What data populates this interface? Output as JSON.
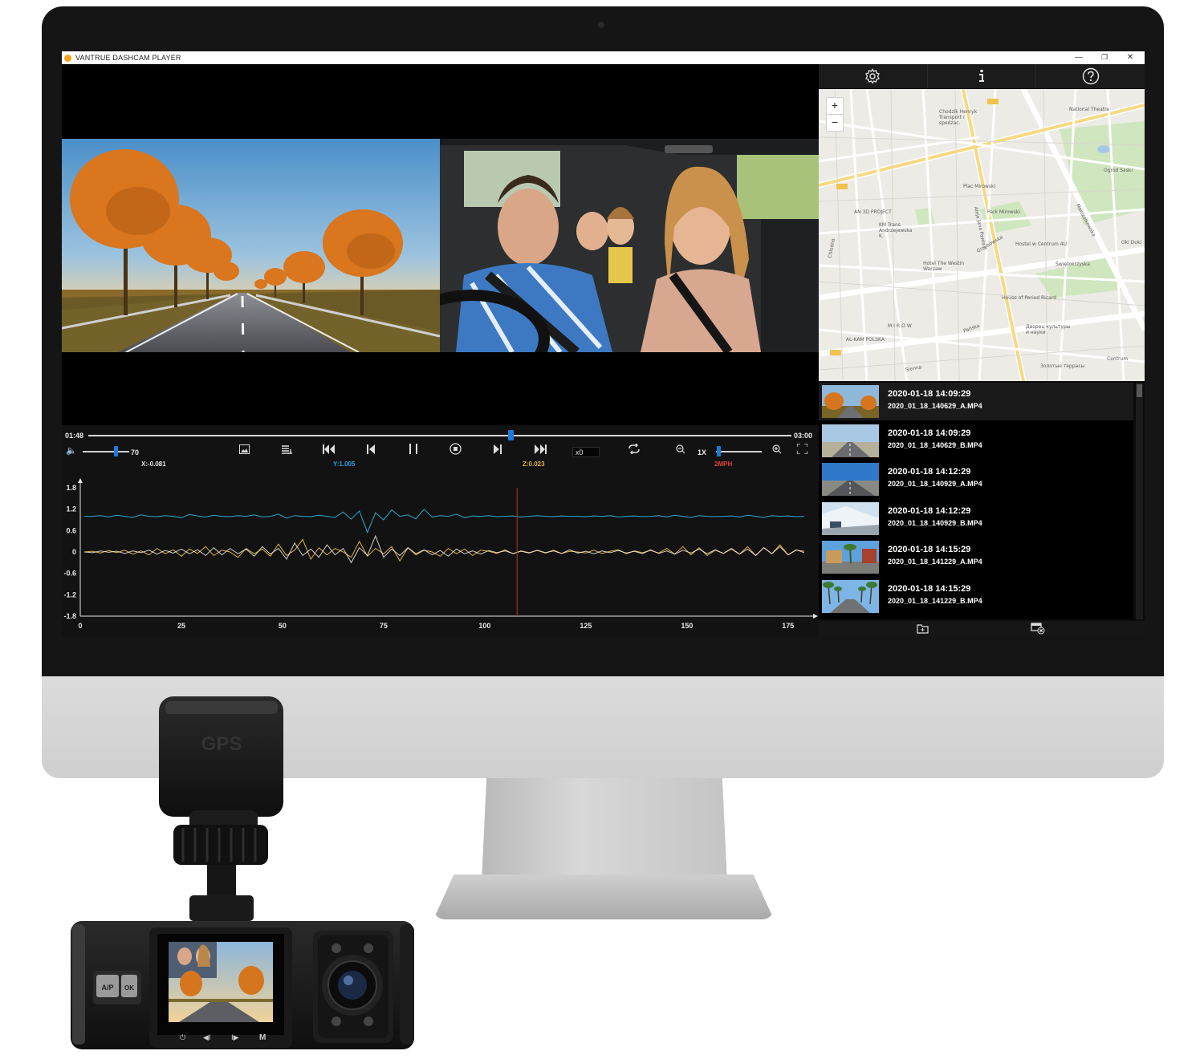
{
  "window": {
    "title": "VANTRUE DASHCAM PLAYER",
    "minimize_glyph": "—",
    "restore_glyph": "❐",
    "close_glyph": "✕"
  },
  "playback": {
    "current_time": "01:48",
    "total_time": "03:00",
    "progress_fraction": 0.6,
    "volume_value": "70",
    "volume_fraction": 0.7,
    "speed_label": "x0",
    "rate_label": "1X",
    "zoom_fraction": 0.05
  },
  "controls": {
    "volume_icon": "speaker-icon",
    "snapshot_icon": "image-icon",
    "playlist_icon": "list-icon",
    "skip_back_icon": "skip-to-start-icon",
    "prev_frame_icon": "previous-icon",
    "pause_icon": "pause-icon",
    "stop_icon": "stop-icon",
    "next_frame_icon": "next-icon",
    "skip_forward_icon": "skip-to-end-icon",
    "loop_icon": "repeat-icon",
    "zoom_out_icon": "zoom-out-icon",
    "zoom_in_icon": "zoom-in-icon",
    "fullscreen_icon": "fullscreen-icon"
  },
  "readouts": {
    "x": {
      "text": "X:-0.081",
      "color": "#e6e6e6"
    },
    "y": {
      "text": "Y:1.005",
      "color": "#2a9fd6"
    },
    "z": {
      "text": "Z:0.023",
      "color": "#e2b13c"
    },
    "speed": {
      "text": "2MPH",
      "color": "#e2403a"
    }
  },
  "chart_data": {
    "type": "line",
    "x_range": [
      0,
      180
    ],
    "ylim": [
      -1.8,
      1.8
    ],
    "yticks": [
      "1.8",
      "1.2",
      "0.6",
      "0",
      "-0.6",
      "-1.2",
      "-1.8"
    ],
    "xticks": [
      "0",
      "25",
      "50",
      "75",
      "100",
      "125",
      "150",
      "175"
    ],
    "cursor_x": 108,
    "series": [
      {
        "color": "#2aa9c9",
        "baseline": 1.0,
        "spike_x": 61,
        "spike_y": 0.5,
        "values": [
          1.0,
          1.0,
          1.02,
          0.98,
          1.03,
          1.0,
          0.97,
          1.04,
          1.0,
          0.99,
          1.02,
          1.0,
          0.96,
          1.05,
          1.01,
          0.98,
          1.03,
          1.0,
          0.99,
          1.02,
          1.0,
          1.04,
          0.98,
          1.0,
          1.06,
          0.95,
          1.02,
          1.0,
          0.99,
          1.03,
          1.0,
          0.97,
          1.12,
          0.92,
          1.15,
          0.55,
          1.1,
          0.9,
          1.18,
          1.0,
          1.04,
          0.93,
          1.2,
          0.98,
          1.02,
          1.0,
          1.06,
          0.96,
          1.01,
          1.0,
          1.02,
          0.99,
          1.0,
          1.01,
          0.98,
          1.0,
          1.02,
          1.0,
          0.99,
          1.01,
          1.0,
          1.0,
          0.99,
          1.01,
          1.0,
          1.02,
          0.98,
          1.0,
          1.01,
          0.99,
          1.0,
          1.02,
          0.98,
          1.03,
          1.0,
          0.97,
          1.02,
          1.0,
          0.99,
          1.0,
          1.01,
          0.98,
          1.03,
          1.0,
          0.97,
          1.02,
          1.0,
          1.01,
          0.99,
          1.0
        ]
      },
      {
        "color": "#e2b13c",
        "baseline": 0.0,
        "values": [
          0.0,
          0.02,
          -0.03,
          0.04,
          -0.02,
          0.05,
          -0.06,
          0.03,
          -0.08,
          0.1,
          -0.05,
          0.06,
          -0.12,
          0.08,
          -0.04,
          0.15,
          -0.1,
          0.05,
          0.0,
          -0.15,
          0.1,
          -0.05,
          0.08,
          -0.12,
          0.22,
          -0.1,
          0.05,
          0.35,
          -0.2,
          0.12,
          -0.08,
          0.1,
          0.0,
          -0.15,
          0.3,
          -0.12,
          0.1,
          -0.05,
          0.15,
          -0.25,
          0.12,
          -0.08,
          0.05,
          0.0,
          -0.12,
          0.1,
          -0.05,
          0.08,
          -0.1,
          0.05,
          0.02,
          -0.04,
          0.06,
          -0.05,
          0.03,
          -0.02,
          0.04,
          -0.03,
          0.05,
          -0.04,
          0.02,
          0.0,
          -0.03,
          0.05,
          -0.04,
          0.02,
          0.06,
          -0.05,
          0.03,
          -0.02,
          0.04,
          -0.03,
          0.1,
          -0.06,
          0.15,
          -0.08,
          0.12,
          -0.1,
          0.05,
          -0.04,
          0.08,
          -0.06,
          0.15,
          -0.1,
          0.12,
          -0.05,
          0.2,
          -0.08,
          0.05,
          0.02
        ]
      },
      {
        "color": "#f2efe6",
        "baseline": 0.0,
        "values": [
          0.0,
          -0.02,
          0.03,
          -0.01,
          0.02,
          -0.04,
          0.03,
          -0.02,
          0.05,
          -0.06,
          0.04,
          -0.03,
          0.08,
          -0.05,
          0.06,
          -0.1,
          0.12,
          -0.08,
          0.1,
          -0.05,
          0.08,
          -0.12,
          0.15,
          -0.06,
          0.1,
          -0.2,
          0.25,
          -0.1,
          0.08,
          -0.15,
          0.2,
          -0.08,
          0.1,
          -0.3,
          0.12,
          -0.1,
          0.45,
          -0.15,
          0.08,
          -0.1,
          0.12,
          -0.05,
          0.06,
          -0.08,
          0.04,
          -0.12,
          0.08,
          -0.05,
          0.03,
          -0.06,
          0.04,
          -0.02,
          0.03,
          -0.04,
          0.02,
          -0.03,
          0.05,
          -0.02,
          0.03,
          -0.04,
          0.06,
          -0.03,
          0.02,
          -0.05,
          0.03,
          -0.02,
          0.04,
          -0.03,
          0.02,
          -0.05,
          0.06,
          -0.04,
          0.03,
          -0.06,
          0.05,
          -0.03,
          0.08,
          -0.05,
          0.06,
          -0.04,
          0.1,
          -0.06,
          0.08,
          -0.1,
          0.12,
          -0.05,
          0.15,
          -0.08,
          0.06,
          -0.02
        ]
      }
    ]
  },
  "side_toolbar": {
    "settings_icon": "gear-icon",
    "info_icon": "info-icon",
    "help_icon": "help-icon"
  },
  "map": {
    "zoom_in": "+",
    "zoom_out": "−",
    "labels": [
      "Chodzik Henryk Transport i spedzac.",
      "National Theatre",
      "Ogród Saski",
      "Plac Mirowski",
      "Park Mirowski",
      "AN 3D PROJECT",
      "KM Trans Andrzejewska K.",
      "Hostel w Centrum 4U",
      "Świętokrzyska",
      "Hotel The Westin Warsaw",
      "House of Period Ricard",
      "MIROW",
      "AL-KAM POLSKA",
      "Дворец культуры и науки",
      "Золотые террасы",
      "Centrum",
      "Oki Doki",
      "Aleja Jana Pawła II",
      "Marszałkowska",
      "Chłodna",
      "Grzybowska",
      "Pańska",
      "Sienna"
    ]
  },
  "files": [
    {
      "date": "2020-01-18 14:09:29",
      "name": "2020_01_18_140629_A.MP4",
      "thumb": "road-autumn"
    },
    {
      "date": "2020-01-18 14:09:29",
      "name": "2020_01_18_140629_B.MP4",
      "thumb": "road-open"
    },
    {
      "date": "2020-01-18 14:12:29",
      "name": "2020_01_18_140929_A.MP4",
      "thumb": "road-blue-sky"
    },
    {
      "date": "2020-01-18 14:12:29",
      "name": "2020_01_18_140929_B.MP4",
      "thumb": "snow-road"
    },
    {
      "date": "2020-01-18 14:15:29",
      "name": "2020_01_18_141229_A.MP4",
      "thumb": "palm-street"
    },
    {
      "date": "2020-01-18 14:15:29",
      "name": "2020_01_18_141229_B.MP4",
      "thumb": "palm-avenue"
    }
  ],
  "list_footer": {
    "open_folder_icon": "folder-icon",
    "delete_icon": "delete-file-icon"
  },
  "dashcam": {
    "gps_label": "GPS",
    "button_ap": "A/P",
    "button_ok": "OK",
    "button_power": "⏻",
    "button_prev": "◀I",
    "button_next": "I▶",
    "button_mode": "M"
  },
  "colors": {
    "accent_blue": "#1e7ad9",
    "app_logo": "#f3a21b",
    "cursor_red": "#c0322a"
  }
}
